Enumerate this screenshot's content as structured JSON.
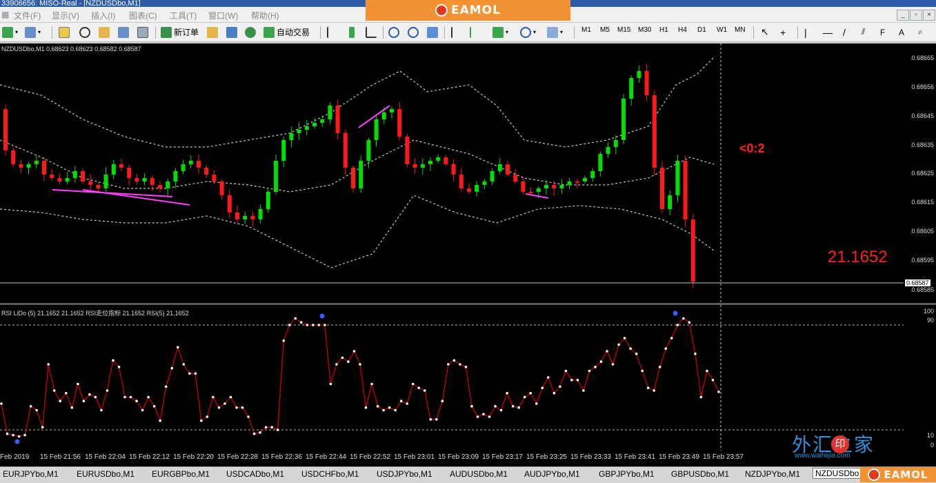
{
  "window": {
    "title": "33906656: MISO-Real - [NZDUSDbo,M1]",
    "min_label": "_",
    "max_label": "▫",
    "close_label": "×"
  },
  "brand": {
    "name": "EAMOL"
  },
  "menu": [
    "文件(F)",
    "显示(V)",
    "插入(I)",
    "图表(C)",
    "工具(T)",
    "窗口(W)",
    "帮助(H)"
  ],
  "toolbar": {
    "new_order": "新订单",
    "auto_trading": "自动交易",
    "timeframes": [
      "M1",
      "M5",
      "M15",
      "M30",
      "H1",
      "H4",
      "D1",
      "W1",
      "MN"
    ]
  },
  "chart": {
    "symbol_header": "NZDUSDbo,M1  0.68623 0.68623 0.68582 0.68587",
    "current_price": "0.68587",
    "price_axis": [
      "0.68665",
      "0.68656",
      "0.68645",
      "0.68635",
      "0.68625",
      "0.68615",
      "0.68605",
      "0.68595",
      "0.68585"
    ],
    "annotation_red": "<0:2",
    "annotation_value": "21.1652",
    "colors": {
      "bull": "#00e000",
      "bear": "#ff1a1a",
      "bands": "#c8c8c8",
      "trend": "#ff40ff"
    }
  },
  "indicator": {
    "header": "RSI LiDo (5) 21.1652 21.1652  RSI走位指标 21.1652  RSI(5) 21.1652",
    "axis": [
      "100",
      "90",
      "10",
      "0"
    ],
    "levels": [
      90,
      10
    ],
    "color": "#cc0000"
  },
  "time_axis": [
    "Feb 2019",
    "15 Feb 21:56",
    "15 Feb 22:04",
    "15 Feb 22:12",
    "15 Feb 22:20",
    "15 Feb 22:28",
    "15 Feb 22:36",
    "15 Feb 22:44",
    "15 Feb 22:52",
    "15 Feb 23:01",
    "15 Feb 23:09",
    "15 Feb 23:17",
    "15 Feb 23:25",
    "15 Feb 23:33",
    "15 Feb 23:41",
    "15 Feb 23:49",
    "15 Feb 23:57"
  ],
  "tabs": [
    "EURJPYbo,M1",
    "EURUSDbo,M1",
    "EURGBPbo,M1",
    "USDCADbo,M1",
    "USDCHFbo,M1",
    "USDJPYbo,M1",
    "AUDUSDbo,M1",
    "AUDJPYbo,M1",
    "GBPJPYbo,M1",
    "GBPUSDbo,M1",
    "NZDJPYbo,M1",
    "NZDUSDbo"
  ],
  "active_tab": "NZDUSDbo",
  "watermark": {
    "text": "外汇之家",
    "badge": "印",
    "url": "www.waihiijia.com"
  }
}
